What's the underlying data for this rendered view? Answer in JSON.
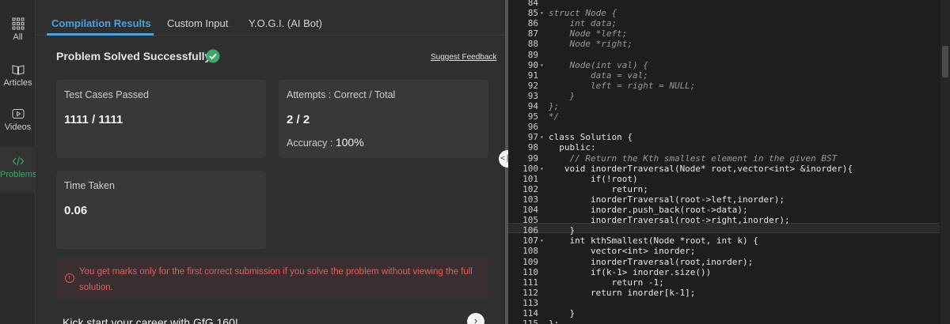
{
  "sidebar": {
    "items": [
      {
        "label": "All",
        "icon": "grid-icon"
      },
      {
        "label": "Articles",
        "icon": "book-icon"
      },
      {
        "label": "Videos",
        "icon": "play-icon"
      },
      {
        "label": "Problems",
        "icon": "code-icon"
      }
    ]
  },
  "tabs": [
    "Compilation Results",
    "Custom Input",
    "Y.O.G.I. (AI Bot)"
  ],
  "result": {
    "title": "Problem Solved Successfully",
    "suggest_feedback": "Suggest Feedback",
    "test_cases_label": "Test Cases Passed",
    "test_cases_value": "1111 / 1111",
    "attempts_label": "Attempts : Correct / Total",
    "attempts_value": "2 / 2",
    "accuracy_label": "Accuracy :",
    "accuracy_value": "100%",
    "time_label": "Time Taken",
    "time_value": "0.06"
  },
  "warning": "You get marks only for the first correct submission if you solve the problem without viewing the full solution.",
  "promo": "Kick start your career with GfG 160!",
  "colors": {
    "accent": "#4aa3df",
    "success": "#3ea86a",
    "error": "#e06060"
  },
  "code": {
    "lines": [
      {
        "n": "84",
        "fold": "",
        "text": "",
        "style": "cmt"
      },
      {
        "n": "85",
        "fold": "▾",
        "text": "struct Node {",
        "style": "cmt"
      },
      {
        "n": "86",
        "fold": "",
        "text": "    int data;",
        "style": "cmt"
      },
      {
        "n": "87",
        "fold": "",
        "text": "    Node *left;",
        "style": "cmt"
      },
      {
        "n": "88",
        "fold": "",
        "text": "    Node *right;",
        "style": "cmt"
      },
      {
        "n": "89",
        "fold": "",
        "text": "",
        "style": "cmt"
      },
      {
        "n": "90",
        "fold": "▾",
        "text": "    Node(int val) {",
        "style": "cmt"
      },
      {
        "n": "91",
        "fold": "",
        "text": "        data = val;",
        "style": "cmt"
      },
      {
        "n": "92",
        "fold": "",
        "text": "        left = right = NULL;",
        "style": "cmt"
      },
      {
        "n": "93",
        "fold": "",
        "text": "    }",
        "style": "cmt"
      },
      {
        "n": "94",
        "fold": "",
        "text": "};",
        "style": "cmt"
      },
      {
        "n": "95",
        "fold": "",
        "text": "*/",
        "style": "cmt"
      },
      {
        "n": "96",
        "fold": "",
        "text": "",
        "style": ""
      },
      {
        "n": "97",
        "fold": "▾",
        "text": "class Solution {",
        "style": ""
      },
      {
        "n": "98",
        "fold": "",
        "text": "  public:",
        "style": ""
      },
      {
        "n": "99",
        "fold": "",
        "text": "    // Return the Kth smallest element in the given BST",
        "style": "cmt"
      },
      {
        "n": "100",
        "fold": "▾",
        "text": "   void inorderTraversal(Node* root,vector<int> &inorder){",
        "style": ""
      },
      {
        "n": "101",
        "fold": "",
        "text": "        if(!root)",
        "style": ""
      },
      {
        "n": "102",
        "fold": "",
        "text": "            return;",
        "style": ""
      },
      {
        "n": "103",
        "fold": "",
        "text": "        inorderTraversal(root->left,inorder);",
        "style": ""
      },
      {
        "n": "104",
        "fold": "",
        "text": "        inorder.push_back(root->data);",
        "style": ""
      },
      {
        "n": "105",
        "fold": "",
        "text": "        inorderTraversal(root->right,inorder);",
        "style": ""
      },
      {
        "n": "106",
        "fold": "",
        "text": "    }",
        "style": ""
      },
      {
        "n": "107",
        "fold": "▾",
        "text": "    int kthSmallest(Node *root, int k) {",
        "style": ""
      },
      {
        "n": "108",
        "fold": "",
        "text": "        vector<int> inorder;",
        "style": ""
      },
      {
        "n": "109",
        "fold": "",
        "text": "        inorderTraversal(root,inorder);",
        "style": ""
      },
      {
        "n": "110",
        "fold": "",
        "text": "        if(k-1> inorder.size())",
        "style": ""
      },
      {
        "n": "111",
        "fold": "",
        "text": "            return -1;",
        "style": ""
      },
      {
        "n": "112",
        "fold": "",
        "text": "        return inorder[k-1];",
        "style": ""
      },
      {
        "n": "113",
        "fold": "",
        "text": "",
        "style": ""
      },
      {
        "n": "114",
        "fold": "",
        "text": "    }",
        "style": ""
      },
      {
        "n": "115",
        "fold": "",
        "text": "};",
        "style": ""
      }
    ]
  }
}
